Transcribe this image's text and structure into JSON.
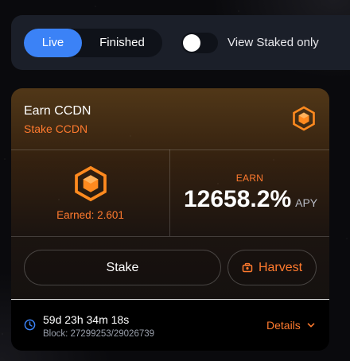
{
  "filters": {
    "tabs": [
      {
        "label": "Live",
        "active": true
      },
      {
        "label": "Finished",
        "active": false
      }
    ],
    "staked_only": {
      "label": "View Staked only",
      "on": false
    }
  },
  "pool": {
    "title": "Earn CCDN",
    "subtitle": "Stake CCDN",
    "token_icon": "ccdn-token-icon",
    "earned_label": "Earned: 2.601",
    "earn_label": "EARN",
    "apy_value": "12658.2%",
    "apy_unit": "APY",
    "stake_label": "Stake",
    "harvest_label": "Harvest",
    "harvest_icon": "harvest-icon",
    "countdown": "59d 23h 34m 18s",
    "block": "Block: 27299253/29026739",
    "details_label": "Details",
    "clock_icon": "clock-icon",
    "details_icon": "chevron-down-icon"
  },
  "colors": {
    "accent": "#ff7a2e",
    "primary": "#3b82f6",
    "panel": "#1b1f29"
  }
}
